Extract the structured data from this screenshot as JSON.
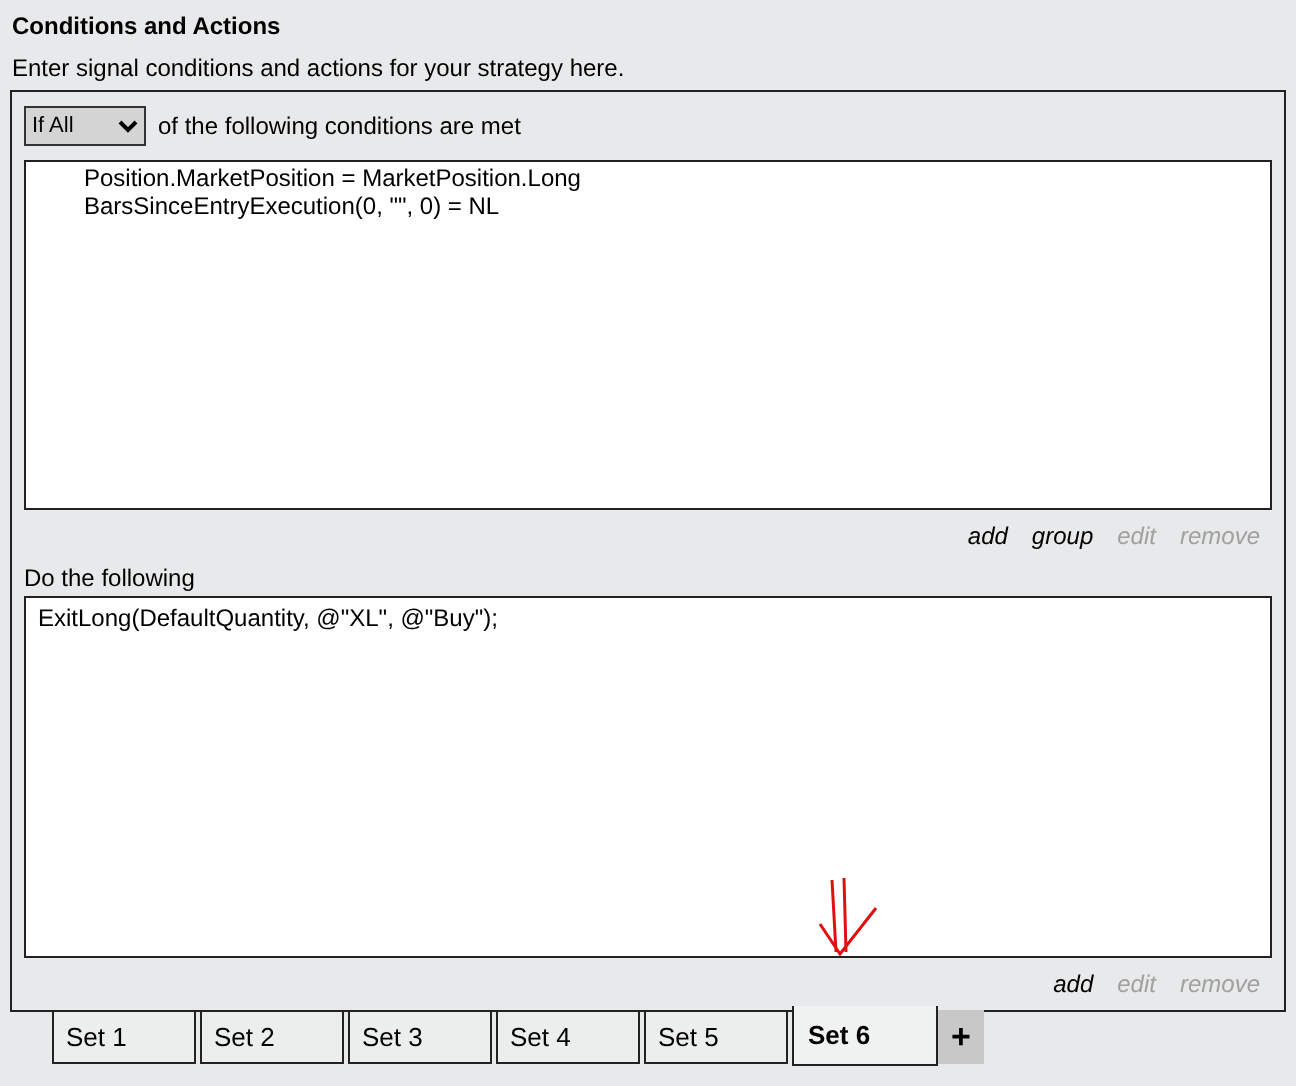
{
  "header": {
    "title": "Conditions and Actions",
    "subtitle": "Enter signal conditions and actions for your strategy here."
  },
  "conditions": {
    "mode": "If All",
    "caption": "of the following conditions are met",
    "lines": [
      "Position.MarketPosition = MarketPosition.Long",
      "BarsSinceEntryExecution(0, \"\", 0) = NL"
    ],
    "links": [
      {
        "label": "add",
        "disabled": false
      },
      {
        "label": "group",
        "disabled": false
      },
      {
        "label": "edit",
        "disabled": true
      },
      {
        "label": "remove",
        "disabled": true
      }
    ]
  },
  "actions": {
    "caption": "Do the following",
    "lines": [
      "ExitLong(DefaultQuantity, @\"XL\", @\"Buy\");"
    ],
    "links": [
      {
        "label": "add",
        "disabled": false
      },
      {
        "label": "edit",
        "disabled": true
      },
      {
        "label": "remove",
        "disabled": true
      }
    ]
  },
  "tabs": [
    {
      "label": "Set 1",
      "selected": false
    },
    {
      "label": "Set 2",
      "selected": false
    },
    {
      "label": "Set 3",
      "selected": false
    },
    {
      "label": "Set 4",
      "selected": false
    },
    {
      "label": "Set 5",
      "selected": false
    },
    {
      "label": "Set 6",
      "selected": true
    }
  ],
  "add_tab": "+"
}
